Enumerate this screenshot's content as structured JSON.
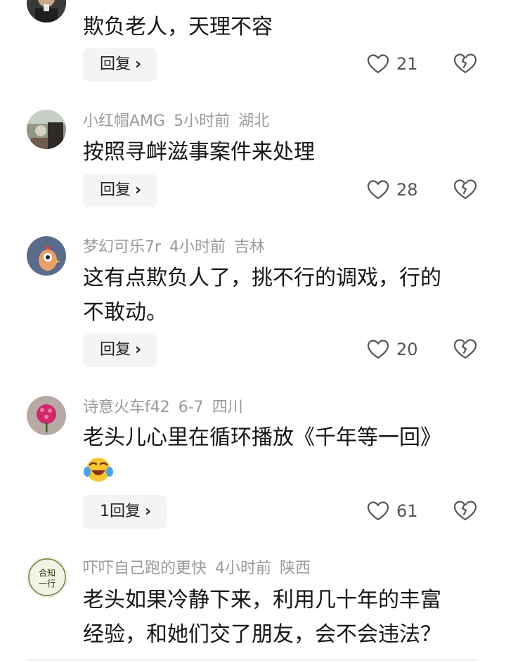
{
  "comments": [
    {
      "username": "",
      "time": "",
      "location": "",
      "text": "欺负老人，天理不容",
      "reply_label": "回复",
      "likes": "21",
      "avatar_icon": "user-avatar-photo-icon"
    },
    {
      "username": "小红帽AMG",
      "time": "5小时前",
      "location": "湖北",
      "text": "按照寻衅滋事案件来处理",
      "reply_label": "回复",
      "likes": "28",
      "avatar_icon": "user-avatar-photo-icon"
    },
    {
      "username": "梦幻可乐7r",
      "time": "4小时前",
      "location": "吉林",
      "text_line1": "这有点欺负人了，挑不行的调戏，行的",
      "text_line2": "不敢动。",
      "reply_label": "回复",
      "likes": "20",
      "avatar_icon": "chicken-avatar-icon"
    },
    {
      "username": "诗意火车f42",
      "time": "6-7",
      "location": "四川",
      "text": "老头儿心里在循环播放《千年等一回》",
      "emoji": "laughing-crying-emoji",
      "reply_label": "1回复",
      "likes": "61",
      "avatar_icon": "pink-flower-avatar-icon"
    },
    {
      "username": "吓吓自己跑的更快",
      "time": "4小时前",
      "location": "陕西",
      "text_line1": "老头如果冷静下来，利用几十年的丰富",
      "text_line2": "经验，和她们交了朋友，会不会违法？",
      "avatar_icon": "calligraphy-avatar-icon",
      "avatar_text": "合知一行"
    }
  ],
  "colors": {
    "meta_gray": "#9a9a9a",
    "button_bg": "#f4f4f4",
    "icon_gray": "#555555"
  }
}
